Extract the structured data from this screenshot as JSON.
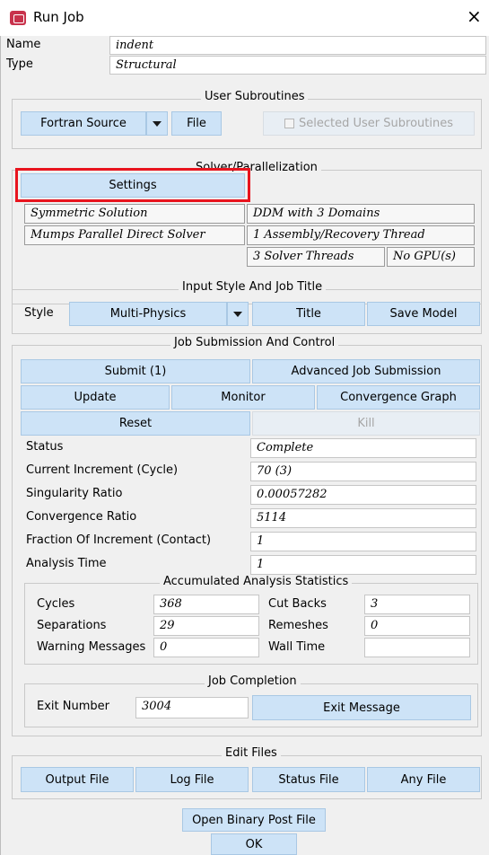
{
  "window": {
    "title": "Run Job",
    "close_glyph": "×"
  },
  "job": {
    "name_label": "Name",
    "name_value": "indent",
    "type_label": "Type",
    "type_value": "Structural"
  },
  "user_subroutines": {
    "title": "User Subroutines",
    "source_select": "Fortran Source",
    "file_button": "File",
    "selected_label": "Selected User Subroutines"
  },
  "solver": {
    "title": "Solver/Parallelization",
    "settings_button": "Settings",
    "symmetric": "Symmetric Solution",
    "ddm": "DDM with 3 Domains",
    "mumps": "Mumps Parallel Direct Solver",
    "assembly": "1 Assembly/Recovery Thread",
    "threads": "3 Solver Threads",
    "gpu": "No GPU(s)"
  },
  "input_style": {
    "title": "Input Style And Job Title",
    "style_label": "Style",
    "style_value": "Multi-Physics",
    "title_button": "Title",
    "save_model_button": "Save Model"
  },
  "submission": {
    "title": "Job Submission And Control",
    "submit": "Submit (1)",
    "advanced": "Advanced Job Submission",
    "update": "Update",
    "monitor": "Monitor",
    "convergence_graph": "Convergence Graph",
    "reset": "Reset",
    "kill": "Kill"
  },
  "status": {
    "status_label": "Status",
    "status_value": "Complete",
    "increment_label": "Current Increment (Cycle)",
    "increment_value": "70 (3)",
    "singularity_label": "Singularity Ratio",
    "singularity_value": "0.00057282",
    "convergence_label": "Convergence Ratio",
    "convergence_value": "5114",
    "fraction_label": "Fraction Of Increment (Contact)",
    "fraction_value": "1",
    "analysis_label": "Analysis Time",
    "analysis_value": "1"
  },
  "accumulated": {
    "title": "Accumulated Analysis Statistics",
    "cycles_label": "Cycles",
    "cycles_value": "368",
    "cutbacks_label": "Cut Backs",
    "cutbacks_value": "3",
    "separations_label": "Separations",
    "separations_value": "29",
    "remeshes_label": "Remeshes",
    "remeshes_value": "0",
    "warnings_label": "Warning Messages",
    "warnings_value": "0",
    "walltime_label": "Wall Time",
    "walltime_value": ""
  },
  "completion": {
    "title": "Job Completion",
    "exit_number_label": "Exit Number",
    "exit_number_value": "3004",
    "exit_message_button": "Exit Message"
  },
  "edit_files": {
    "title": "Edit Files",
    "output": "Output File",
    "log": "Log File",
    "status": "Status File",
    "any": "Any File"
  },
  "footer": {
    "open_post": "Open Binary Post File",
    "ok": "OK"
  },
  "colors": {
    "button_bg": "#cde3f7",
    "highlight": "#e8141e",
    "panel_bg": "#f0f0f0"
  }
}
